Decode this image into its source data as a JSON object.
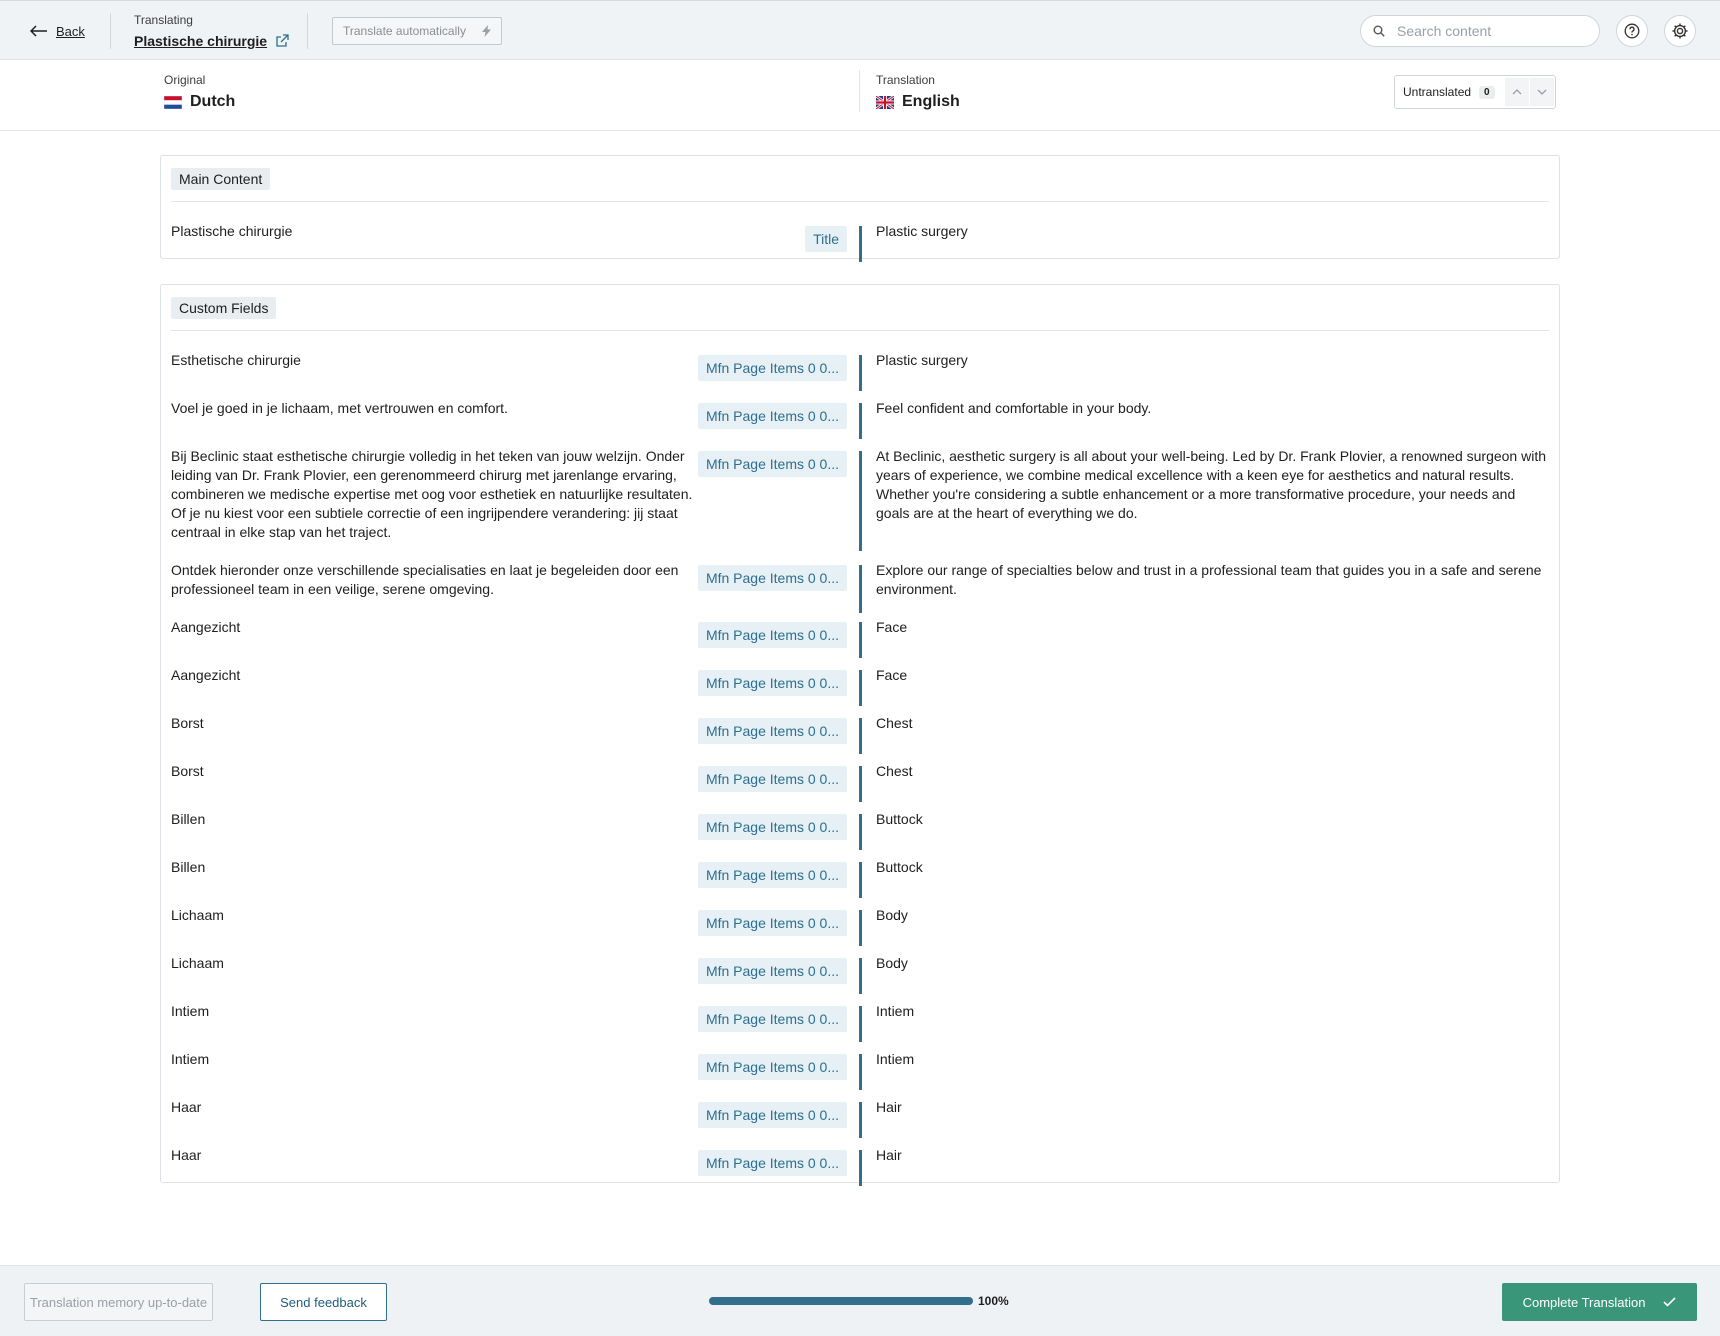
{
  "header": {
    "back_label": "Back",
    "context_label": "Translating",
    "page_title": "Plastische chirurgie",
    "translate_auto_label": "Translate automatically",
    "search_placeholder": "Search content"
  },
  "languages": {
    "original_caption": "Original",
    "original_name": "Dutch",
    "translation_caption": "Translation",
    "translation_name": "English",
    "untranslated_label": "Untranslated",
    "untranslated_count": "0"
  },
  "sections": {
    "main": {
      "label": "Main Content",
      "rows": [
        {
          "source": "Plastische chirurgie",
          "field": "Title",
          "target": "Plastic surgery"
        }
      ]
    },
    "custom": {
      "label": "Custom Fields",
      "rows": [
        {
          "source": "Esthetische chirurgie",
          "field": "Mfn Page Items 0 0...",
          "target": "Plastic surgery"
        },
        {
          "source": "Voel je goed in je lichaam, met vertrouwen en comfort.",
          "field": "Mfn Page Items 0 0...",
          "target": "Feel confident and comfortable in your body."
        },
        {
          "source": "Bij Beclinic staat esthetische chirurgie volledig in het teken van jouw welzijn. Onder leiding van Dr. Frank Plovier, een gerenommeerd chirurg met jarenlange ervaring, combineren we medische expertise met oog voor esthetiek en natuurlijke resultaten. Of je nu kiest voor een subtiele correctie of een ingrijpendere verandering: jij staat centraal in elke stap van het traject.",
          "field": "Mfn Page Items 0 0...",
          "target": "At Beclinic, aesthetic surgery is all about your well-being. Led by Dr. Frank Plovier, a renowned surgeon with years of experience, we combine medical excellence with a keen eye for aesthetics and natural results. Whether you're considering a subtle enhancement or a more transformative procedure, your needs and goals are at the heart of everything we do."
        },
        {
          "source": "Ontdek hieronder onze verschillende specialisaties en laat je begeleiden door een professioneel team in een veilige, serene omgeving.",
          "field": "Mfn Page Items 0 0...",
          "target": "Explore our range of specialties below and trust in a professional team that guides you in a safe and serene environment."
        },
        {
          "source": "Aangezicht",
          "field": "Mfn Page Items 0 0...",
          "target": "Face"
        },
        {
          "source": "Aangezicht",
          "field": "Mfn Page Items 0 0...",
          "target": "Face"
        },
        {
          "source": "Borst",
          "field": "Mfn Page Items 0 0...",
          "target": "Chest"
        },
        {
          "source": "Borst",
          "field": "Mfn Page Items 0 0...",
          "target": "Chest"
        },
        {
          "source": "Billen",
          "field": "Mfn Page Items 0 0...",
          "target": "Buttock"
        },
        {
          "source": "Billen",
          "field": "Mfn Page Items 0 0...",
          "target": "Buttock"
        },
        {
          "source": "Lichaam",
          "field": "Mfn Page Items 0 0...",
          "target": "Body"
        },
        {
          "source": "Lichaam",
          "field": "Mfn Page Items 0 0...",
          "target": "Body"
        },
        {
          "source": "Intiem",
          "field": "Mfn Page Items 0 0...",
          "target": "Intiem"
        },
        {
          "source": "Intiem",
          "field": "Mfn Page Items 0 0...",
          "target": "Intiem"
        },
        {
          "source": "Haar",
          "field": "Mfn Page Items 0 0...",
          "target": "Hair"
        },
        {
          "source": "Haar",
          "field": "Mfn Page Items 0 0...",
          "target": "Hair"
        }
      ]
    }
  },
  "footer": {
    "memory_label": "Translation memory up-to-date",
    "feedback_label": "Send feedback",
    "progress": 1.0,
    "progress_label": "100%",
    "complete_label": "Complete Translation"
  },
  "colors": {
    "accent": "#336f8c",
    "complete": "#3a9678",
    "field_tag_bg": "#e7f0f4"
  },
  "icons": {
    "back": "arrow-left-icon",
    "open_external": "external-link-icon",
    "auto_translate": "lightning-icon",
    "search": "search-icon",
    "help": "question-circle-icon",
    "settings": "gear-icon",
    "flag_original": "netherlands-flag-icon",
    "flag_translation": "uk-flag-icon",
    "prev": "chevron-up-icon",
    "next": "chevron-down-icon",
    "complete": "check-icon"
  }
}
